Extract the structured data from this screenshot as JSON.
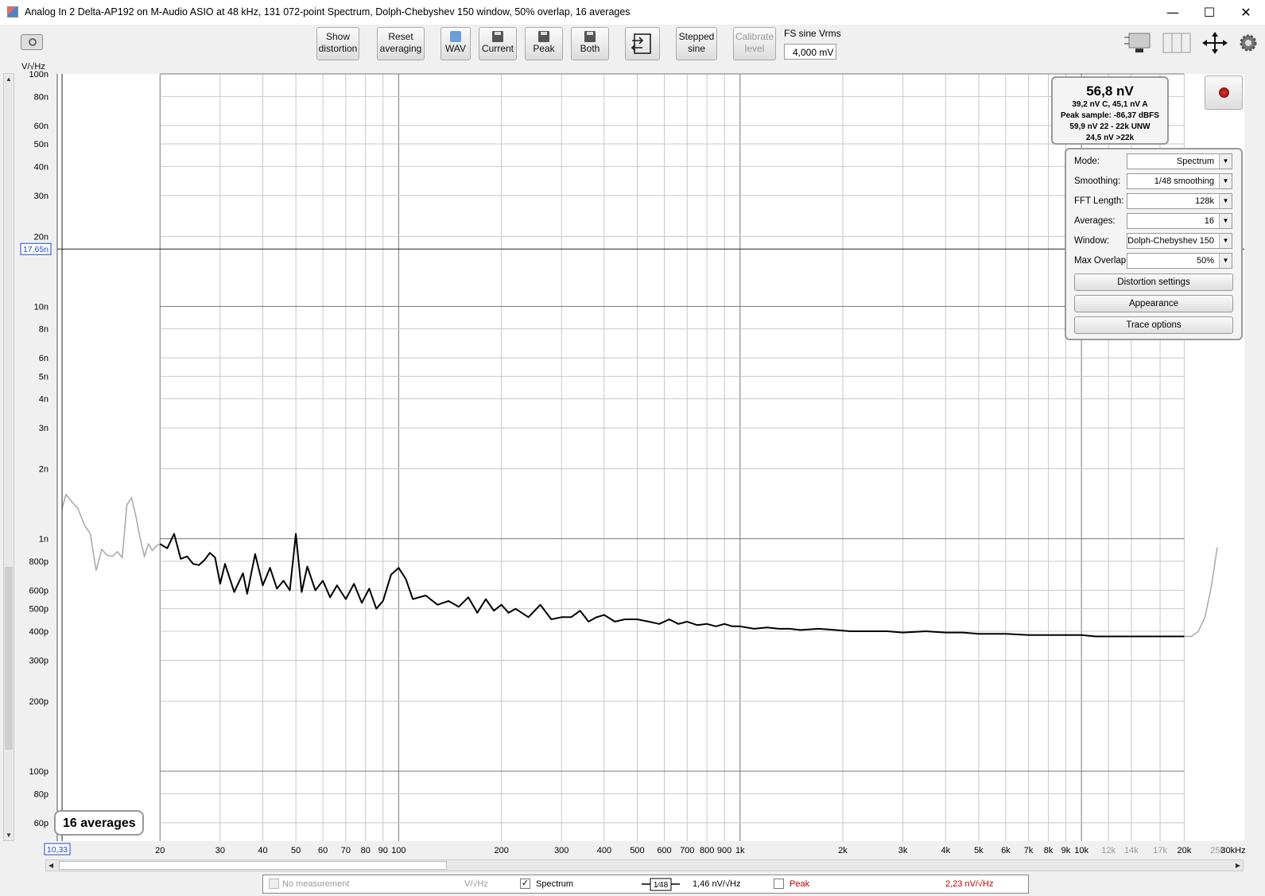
{
  "window": {
    "title": "Analog In 2 Delta-AP192 on M-Audio ASIO at 48 kHz, 131 072-point Spectrum, Dolph-Chebyshev 150 window, 50% overlap, 16 averages",
    "minimize": "—",
    "maximize": "☐",
    "close": "✕"
  },
  "toolbar": {
    "show_distortion": [
      "Show",
      "distortion"
    ],
    "reset_averaging": [
      "Reset",
      "averaging"
    ],
    "wav": "WAV",
    "current": "Current",
    "peak": "Peak",
    "both": "Both",
    "stepped_sine": [
      "Stepped",
      "sine"
    ],
    "calibrate_level": [
      "Calibrate",
      "level"
    ],
    "fs_label": "FS sine Vrms",
    "fs_value": "4,000 mV"
  },
  "readout": {
    "main": "56,8 nV",
    "line1": "39,2 nV C, 45,1 nV A",
    "line2": "Peak sample: -86,37 dBFS",
    "line3": "59,9 nV 22 - 22k UNW",
    "line4": "24,5 nV >22k"
  },
  "settings": {
    "mode_label": "Mode:",
    "mode": "Spectrum",
    "smoothing_label": "Smoothing:",
    "smoothing": "1/48 smoothing",
    "fft_label": "FFT Length:",
    "fft": "128k",
    "averages_label": "Averages:",
    "averages": "16",
    "window_label": "Window:",
    "window": "Dolph-Chebyshev 150",
    "overlap_label": "Max Overlap:",
    "overlap": "50%",
    "distortion_settings": "Distortion settings",
    "appearance": "Appearance",
    "trace_options": "Trace options"
  },
  "badge": "16 averages",
  "cursor": {
    "y_readout": "17,65n",
    "x_readout": "10,33"
  },
  "legend": {
    "no_measurement": "No measurement",
    "unit1": "V/√Hz",
    "spectrum": "Spectrum",
    "smoothing_symbol": "1⁄48",
    "spectrum_value": "1,46 nV/√Hz",
    "peak": "Peak",
    "peak_value": "2,23 nV/√Hz",
    "checked_mark": "✓"
  },
  "colors": {
    "trace": "#000000",
    "trace_outside": "#a8a8a8",
    "peak_text": "#c00000",
    "cursor_box": "#2244cc"
  },
  "chart_data": {
    "type": "line",
    "ylabel": "V/√Hz",
    "x_scale": "log",
    "y_scale": "log",
    "xlim": [
      10,
      30000
    ],
    "ylim": [
      5e-11,
      1e-07
    ],
    "x_ticks": [
      {
        "v": 20,
        "t": "20"
      },
      {
        "v": 30,
        "t": "30"
      },
      {
        "v": 40,
        "t": "40"
      },
      {
        "v": 50,
        "t": "50"
      },
      {
        "v": 60,
        "t": "60"
      },
      {
        "v": 70,
        "t": "70"
      },
      {
        "v": 80,
        "t": "80"
      },
      {
        "v": 90,
        "t": "90"
      },
      {
        "v": 100,
        "t": "100"
      },
      {
        "v": 200,
        "t": "200"
      },
      {
        "v": 300,
        "t": "300"
      },
      {
        "v": 400,
        "t": "400"
      },
      {
        "v": 500,
        "t": "500"
      },
      {
        "v": 600,
        "t": "600"
      },
      {
        "v": 700,
        "t": "700"
      },
      {
        "v": 800,
        "t": "800"
      },
      {
        "v": 900,
        "t": "900"
      },
      {
        "v": 1000,
        "t": "1k"
      },
      {
        "v": 2000,
        "t": "2k"
      },
      {
        "v": 3000,
        "t": "3k"
      },
      {
        "v": 4000,
        "t": "4k"
      },
      {
        "v": 5000,
        "t": "5k"
      },
      {
        "v": 6000,
        "t": "6k"
      },
      {
        "v": 7000,
        "t": "7k"
      },
      {
        "v": 8000,
        "t": "8k"
      },
      {
        "v": 9000,
        "t": "9k"
      },
      {
        "v": 10000,
        "t": "10k"
      },
      {
        "v": 12000,
        "t": "12k",
        "grey": true
      },
      {
        "v": 14000,
        "t": "14k",
        "grey": true
      },
      {
        "v": 17000,
        "t": "17k",
        "grey": true
      },
      {
        "v": 20000,
        "t": "20k"
      },
      {
        "v": 25000,
        "t": "25k",
        "grey": true
      },
      {
        "v": 30000,
        "t": "30kHz"
      }
    ],
    "y_ticks": [
      {
        "v": 1e-07,
        "t": "100n"
      },
      {
        "v": 8e-08,
        "t": "80n"
      },
      {
        "v": 6e-08,
        "t": "60n"
      },
      {
        "v": 5e-08,
        "t": "50n"
      },
      {
        "v": 4e-08,
        "t": "40n"
      },
      {
        "v": 3e-08,
        "t": "30n"
      },
      {
        "v": 2e-08,
        "t": "20n"
      },
      {
        "v": 1e-08,
        "t": "10n"
      },
      {
        "v": 8e-09,
        "t": "8n"
      },
      {
        "v": 6e-09,
        "t": "6n"
      },
      {
        "v": 5e-09,
        "t": "5n"
      },
      {
        "v": 4e-09,
        "t": "4n"
      },
      {
        "v": 3e-09,
        "t": "3n"
      },
      {
        "v": 2e-09,
        "t": "2n"
      },
      {
        "v": 1e-09,
        "t": "1n"
      },
      {
        "v": 8e-10,
        "t": "800p"
      },
      {
        "v": 6e-10,
        "t": "600p"
      },
      {
        "v": 5e-10,
        "t": "500p"
      },
      {
        "v": 4e-10,
        "t": "400p"
      },
      {
        "v": 3e-10,
        "t": "300p"
      },
      {
        "v": 2e-10,
        "t": "200p"
      },
      {
        "v": 1e-10,
        "t": "100p"
      },
      {
        "v": 8e-11,
        "t": "80p"
      },
      {
        "v": 6e-11,
        "t": "60p"
      }
    ],
    "cursor": {
      "x": 10.33,
      "y": 1.765e-08
    },
    "series": [
      {
        "name": "Spectrum",
        "x": [
          20,
          21,
          22,
          23,
          24,
          25,
          26,
          27,
          28,
          29,
          30,
          31,
          33,
          35,
          36,
          38,
          40,
          42,
          44,
          46,
          48,
          50,
          52,
          54,
          57,
          60,
          63,
          66,
          70,
          74,
          78,
          82,
          86,
          90,
          95,
          100,
          105,
          110,
          120,
          130,
          140,
          150,
          160,
          170,
          180,
          190,
          200,
          210,
          220,
          240,
          260,
          280,
          300,
          320,
          340,
          360,
          380,
          400,
          430,
          460,
          500,
          540,
          580,
          620,
          660,
          700,
          750,
          800,
          850,
          900,
          950,
          1000,
          1100,
          1200,
          1300,
          1400,
          1500,
          1700,
          1900,
          2100,
          2400,
          2700,
          3000,
          3500,
          4000,
          4500,
          5000,
          6000,
          7000,
          8000,
          9000,
          10000,
          11000,
          12000,
          13000,
          14000,
          15000,
          16000,
          17000,
          18000,
          19000,
          20000
        ],
        "y": [
          9.5e-10,
          9.1e-10,
          1.05e-09,
          8.2e-10,
          8.4e-10,
          7.8e-10,
          7.7e-10,
          8.1e-10,
          8.7e-10,
          8.3e-10,
          6.4e-10,
          7.8e-10,
          5.9e-10,
          7.1e-10,
          5.8e-10,
          8.6e-10,
          6.3e-10,
          7.5e-10,
          6.1e-10,
          6.6e-10,
          6e-10,
          1.05e-09,
          5.9e-10,
          7.6e-10,
          6e-10,
          6.6e-10,
          5.6e-10,
          6.3e-10,
          5.5e-10,
          6.4e-10,
          5.3e-10,
          6.1e-10,
          5e-10,
          5.4e-10,
          7e-10,
          7.5e-10,
          6.7e-10,
          5.5e-10,
          5.7e-10,
          5.2e-10,
          5.4e-10,
          5.1e-10,
          5.6e-10,
          4.8e-10,
          5.5e-10,
          4.9e-10,
          5.2e-10,
          4.8e-10,
          5e-10,
          4.6e-10,
          5.2e-10,
          4.5e-10,
          4.6e-10,
          4.6e-10,
          4.9e-10,
          4.4e-10,
          4.6e-10,
          4.7e-10,
          4.4e-10,
          4.5e-10,
          4.5e-10,
          4.4e-10,
          4.3e-10,
          4.5e-10,
          4.3e-10,
          4.4e-10,
          4.25e-10,
          4.3e-10,
          4.2e-10,
          4.3e-10,
          4.2e-10,
          4.2e-10,
          4.1e-10,
          4.15e-10,
          4.1e-10,
          4.1e-10,
          4.05e-10,
          4.1e-10,
          4.05e-10,
          4e-10,
          4e-10,
          4e-10,
          3.95e-10,
          4e-10,
          3.95e-10,
          3.95e-10,
          3.9e-10,
          3.9e-10,
          3.85e-10,
          3.85e-10,
          3.85e-10,
          3.85e-10,
          3.8e-10,
          3.8e-10,
          3.8e-10,
          3.8e-10,
          3.8e-10,
          3.8e-10,
          3.8e-10,
          3.8e-10,
          3.8e-10,
          3.8e-10
        ]
      },
      {
        "name": "Spectrum (outside range)",
        "low_x": [
          10.33,
          10.6,
          11,
          11.5,
          12,
          12.5,
          13,
          13.5,
          14,
          14.5,
          15,
          15.5,
          16,
          16.5,
          17,
          17.5,
          18,
          18.5,
          19,
          19.5,
          20
        ],
        "low_y": [
          1.35e-09,
          1.55e-09,
          1.45e-09,
          1.35e-09,
          1.15e-09,
          1.05e-09,
          7.3e-10,
          9e-10,
          8.5e-10,
          8.4e-10,
          8.8e-10,
          8.3e-10,
          1.4e-09,
          1.5e-09,
          1.25e-09,
          1e-09,
          8.4e-10,
          9.5e-10,
          8.9e-10,
          9.3e-10,
          9.5e-10
        ],
        "high_x": [
          20000,
          21000,
          22000,
          23000,
          24000,
          25000
        ],
        "high_y": [
          3.8e-10,
          3.8e-10,
          4e-10,
          4.6e-10,
          6.2e-10,
          9.2e-10
        ]
      }
    ]
  }
}
